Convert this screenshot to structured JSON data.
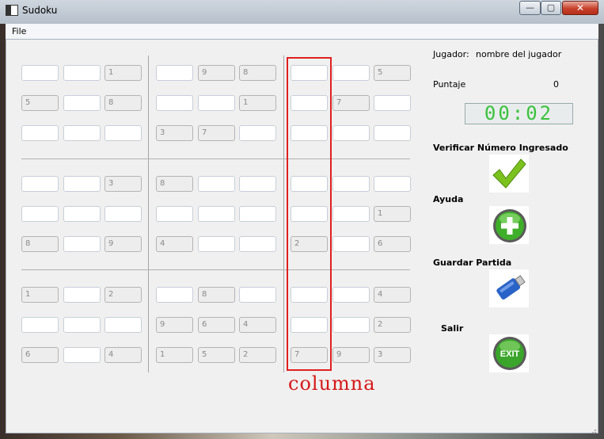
{
  "window": {
    "title": "Sudoku"
  },
  "titlebar_buttons": {
    "minimize": "—",
    "maximize": "▢",
    "close": "✕"
  },
  "menu": {
    "file": "File"
  },
  "board": {
    "rows": [
      [
        "",
        "",
        "1",
        "",
        "9",
        "8",
        "",
        "",
        "5"
      ],
      [
        "5",
        "",
        "8",
        "",
        "",
        "1",
        "",
        "7",
        ""
      ],
      [
        "",
        "",
        "",
        "3",
        "7",
        "",
        "",
        "",
        ""
      ],
      [
        "",
        "",
        "3",
        "8",
        "",
        "",
        "",
        "",
        ""
      ],
      [
        "",
        "",
        "",
        "",
        "",
        "",
        "",
        "",
        "1"
      ],
      [
        "8",
        "",
        "9",
        "4",
        "",
        "",
        "2",
        "",
        "6"
      ],
      [
        "1",
        "",
        "2",
        "",
        "8",
        "",
        "",
        "",
        "4"
      ],
      [
        "",
        "",
        "",
        "9",
        "6",
        "4",
        "",
        "",
        "2"
      ],
      [
        "6",
        "",
        "4",
        "1",
        "5",
        "2",
        "7",
        "9",
        "3"
      ]
    ]
  },
  "sidebar": {
    "player_label": "Jugador:",
    "player_name": "nombre del jugador",
    "score_label": "Puntaje",
    "score_value": "0",
    "timer": "00:02",
    "verify_label": "Verificar Número Ingresado",
    "help_label": "Ayuda",
    "save_label": "Guardar Partida",
    "exit_label": "Salir",
    "icons": {
      "verify": "checkmark-icon",
      "help": "plus-icon",
      "save": "usb-drive-icon",
      "exit": "exit-icon"
    }
  },
  "annotation": {
    "text": "columna"
  },
  "colors": {
    "annotation": "#d61818",
    "timer_digits": "#39c23c"
  }
}
